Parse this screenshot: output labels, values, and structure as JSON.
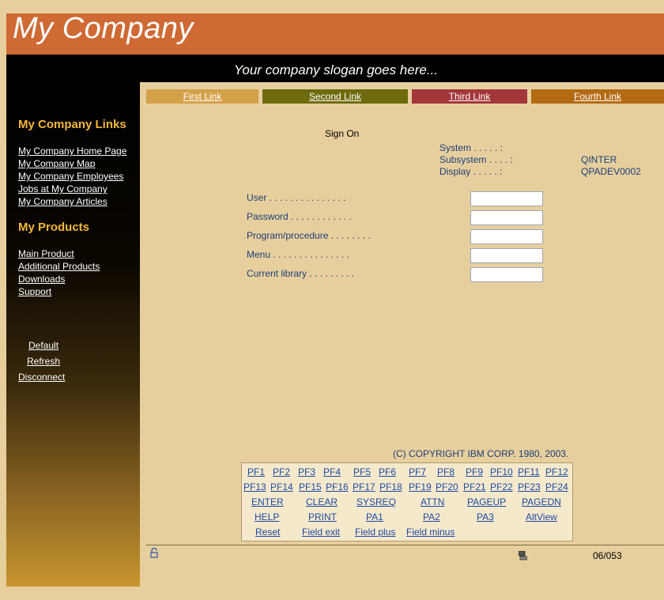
{
  "banner": {
    "title": "My Company",
    "slogan": "Your company slogan goes here..."
  },
  "nav": [
    {
      "label": "First Link",
      "color": "#d4a048"
    },
    {
      "label": "Second Link",
      "color": "#6f6a0e"
    },
    {
      "label": "Third Link",
      "color": "#a3363a"
    },
    {
      "label": "Fourth Link",
      "color": "#b46a12"
    }
  ],
  "sidebar": {
    "company_heading": "My Company Links",
    "company_links": [
      "My Company Home Page",
      "My Company Map",
      "My Company Employees",
      "Jobs at My Company",
      "My Company Articles"
    ],
    "products_heading": "My Products",
    "product_links": [
      "Main Product",
      "Additional Products",
      "Downloads",
      "Support"
    ],
    "actions": [
      "Default",
      "Refresh",
      "Disconnect"
    ]
  },
  "signon": {
    "title": "Sign On",
    "system_label": "System . . . . . :",
    "subsystem_label": "Subsystem . . . . :",
    "subsystem_value": "QINTER",
    "display_label": "Display . . . . . :",
    "display_value": "QPADEV0002",
    "fields": [
      {
        "label": "User . . . . . . . . . . . . . . .",
        "value": ""
      },
      {
        "label": "Password . . . . . . . . . . . .",
        "value": ""
      },
      {
        "label": "Program/procedure . . . . . . . .",
        "value": ""
      },
      {
        "label": "Menu . . . . . . . . . . . . . . .",
        "value": ""
      },
      {
        "label": "Current library . . . . . . . . .",
        "value": ""
      }
    ],
    "copyright": "(C) COPYRIGHT IBM CORP. 1980, 2003."
  },
  "keys": {
    "row1": [
      "PF1",
      "PF2",
      "PF3",
      "PF4",
      "PF5",
      "PF6",
      "PF7",
      "PF8",
      "PF9",
      "PF10",
      "PF11",
      "PF12"
    ],
    "row2": [
      "PF13",
      "PF14",
      "PF15",
      "PF16",
      "PF17",
      "PF18",
      "PF19",
      "PF20",
      "PF21",
      "PF22",
      "PF23",
      "PF24"
    ],
    "row3": [
      "ENTER",
      "CLEAR",
      "SYSREQ",
      "ATTN",
      "PAGEUP",
      "PAGEDN"
    ],
    "row4": [
      "HELP",
      "PRINT",
      "PA1",
      "PA2",
      "PA3",
      "AltView"
    ],
    "row5": [
      "Reset",
      "Field exit",
      "Field plus",
      "Field minus"
    ]
  },
  "status": {
    "lock_icon": "unlock-icon",
    "computer_icon": "computer-icon",
    "cursor_pos": "06/053"
  }
}
